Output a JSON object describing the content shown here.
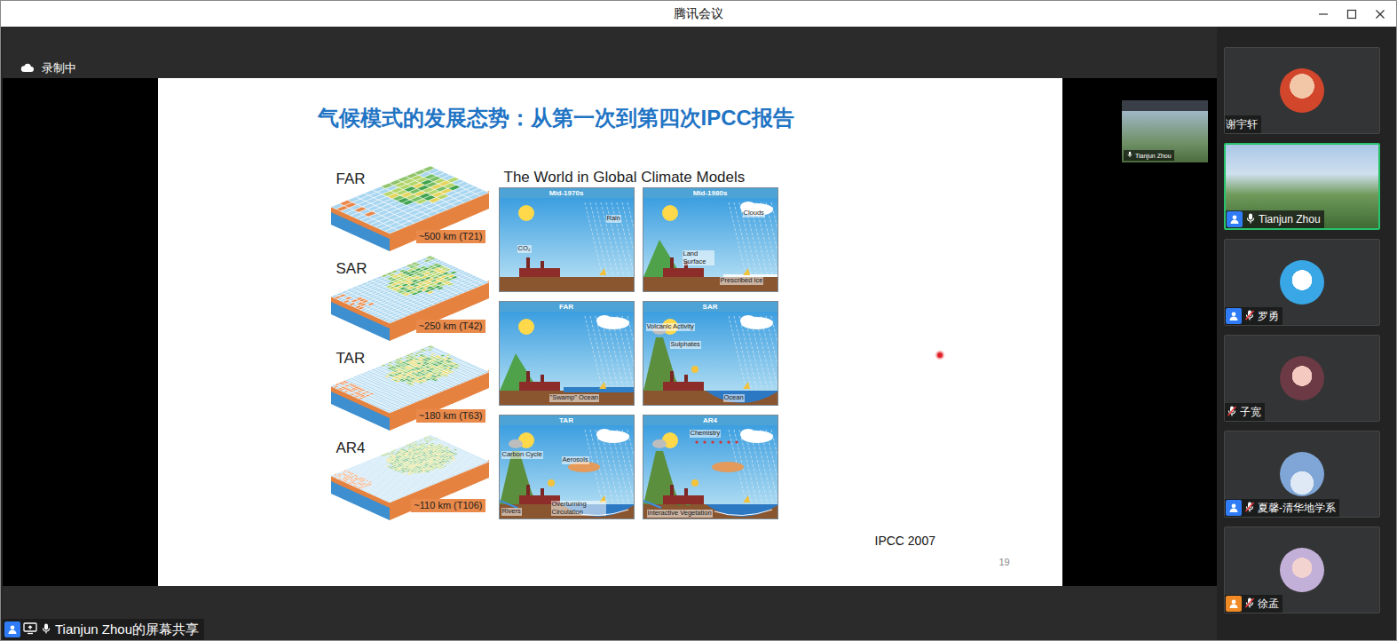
{
  "window": {
    "title": "腾讯会议"
  },
  "recording": {
    "label": "录制中"
  },
  "share": {
    "label": "Tianjun Zhou的屏幕共享",
    "muted": false
  },
  "floating_video": {
    "name": "Tianjun Zhou",
    "muted": false
  },
  "slide": {
    "title": "气候模式的发展态势：从第一次到第四次IPCC报告",
    "models": [
      {
        "label": "FAR",
        "resolution": "~500 km (T21)"
      },
      {
        "label": "SAR",
        "resolution": "~250 km (T42)"
      },
      {
        "label": "TAR",
        "resolution": "~180 km (T63)"
      },
      {
        "label": "AR4",
        "resolution": "~110 km (T106)"
      }
    ],
    "panels_title": "The World in Global Climate Models",
    "panels": [
      {
        "era": "Mid-1970s",
        "labels": [
          "Rain",
          "CO₂"
        ]
      },
      {
        "era": "Mid-1980s",
        "labels": [
          "Clouds",
          "Land Surface",
          "Prescribed Ice"
        ]
      },
      {
        "era": "FAR",
        "labels": [
          "\"Swamp\" Ocean"
        ]
      },
      {
        "era": "SAR",
        "labels": [
          "Volcanic Activity",
          "Sulphates",
          "Ocean"
        ]
      },
      {
        "era": "TAR",
        "labels": [
          "Carbon Cycle",
          "Aerosols",
          "Rivers",
          "Overturning Circulation"
        ]
      },
      {
        "era": "AR4",
        "labels": [
          "Chemistry",
          "Interactive Vegetation"
        ]
      }
    ],
    "source": "IPCC 2007",
    "page": "19"
  },
  "participants": [
    {
      "name": "谢宇轩",
      "kind": "avatar",
      "selected": false,
      "mic_shown": false,
      "muted": false,
      "badge": false
    },
    {
      "name": "Tianjun Zhou",
      "kind": "video",
      "selected": true,
      "mic_shown": true,
      "muted": false,
      "badge": true,
      "color": "#2f7cf6"
    },
    {
      "name": "罗勇",
      "kind": "avatar",
      "selected": false,
      "mic_shown": true,
      "muted": true,
      "badge": true,
      "color": "#2f7cf6"
    },
    {
      "name": "子宽",
      "kind": "avatar",
      "selected": false,
      "mic_shown": true,
      "muted": true,
      "badge": false
    },
    {
      "name": "夏馨-清华地学系",
      "kind": "avatar",
      "selected": false,
      "mic_shown": true,
      "muted": true,
      "badge": true,
      "color": "#2f7cf6"
    },
    {
      "name": "徐孟",
      "kind": "avatar",
      "selected": false,
      "mic_shown": true,
      "muted": true,
      "badge": true,
      "color": "#f08a24"
    }
  ]
}
